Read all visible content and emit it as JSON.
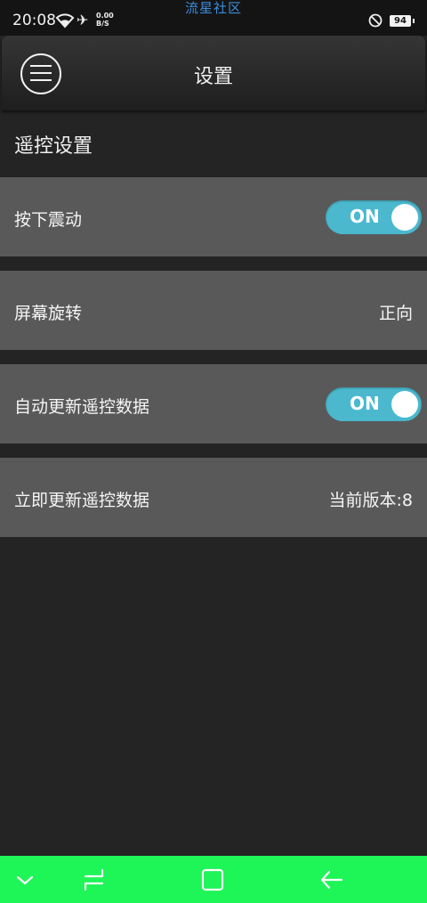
{
  "status_bar": {
    "time": "20:08",
    "net_speed_value": "0.00",
    "net_speed_unit": "B/S",
    "carrier_text": "流星社区",
    "battery": "94"
  },
  "header": {
    "title": "设置"
  },
  "section": {
    "title": "遥控设置"
  },
  "rows": [
    {
      "label": "按下震动",
      "toggle_text": "ON",
      "toggle_on": true
    },
    {
      "label": "屏幕旋转",
      "value": "正向"
    },
    {
      "label": "自动更新遥控数据",
      "toggle_text": "ON",
      "toggle_on": true
    },
    {
      "label": "立即更新遥控数据",
      "value": "当前版本:8"
    }
  ],
  "colors": {
    "background": "#242424",
    "row": "#595959",
    "toggle_on": "#4bb8ce",
    "nav_bar": "#1ef557",
    "carrier_text": "#3d8bdc"
  },
  "nav_bar": {
    "icons": [
      "chevron-down-icon",
      "menu-recent-icon",
      "home-square-icon",
      "back-arrow-icon"
    ]
  }
}
